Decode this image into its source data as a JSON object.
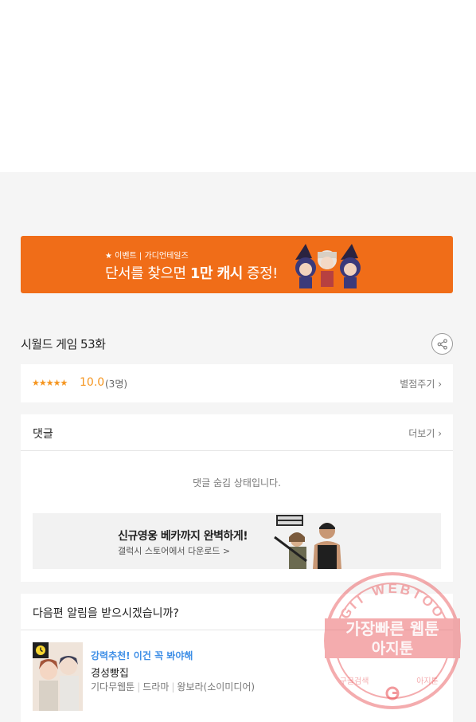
{
  "banner": {
    "small_text": "★ 이벤트 | 가디언테일즈",
    "main_text_pre": "단서를 찾으면 ",
    "main_text_bold": "1만 캐시",
    "main_text_post": " 증정!"
  },
  "episode": {
    "title": "시월드 게임 53화"
  },
  "rating": {
    "stars": "★★★★★",
    "score": "10.0",
    "count": "(3명)",
    "rate_link": "별점주기 ›"
  },
  "comments": {
    "title": "댓글",
    "more_link": "더보기 ›",
    "hidden_message": "댓글 숨김 상태입니다.",
    "ad_title": "신규영웅 베카까지 완벽하게!",
    "ad_subtitle": "갤럭시 스토어에서 다운로드 >"
  },
  "notify": {
    "question": "다음편 알림을 받으시겠습니까?",
    "recommend_tag": "강력추천! 이건 꼭 봐야해",
    "recommend_title": "경성빵집",
    "meta": [
      "기다무웹툰",
      "드라마",
      "왕보라(소이미디어)"
    ]
  },
  "watermark": {
    "ring_text": "AGIT WEBTOON",
    "line1": "가장빠른 웹툰",
    "line2": "아지툰",
    "bottom_left": "구글검색",
    "bottom_right": "아지툰"
  },
  "colors": {
    "banner_bg": "#f06d18",
    "star": "#f5951f",
    "link_blue": "#3d8ee6",
    "watermark_red": "#e8494e"
  }
}
